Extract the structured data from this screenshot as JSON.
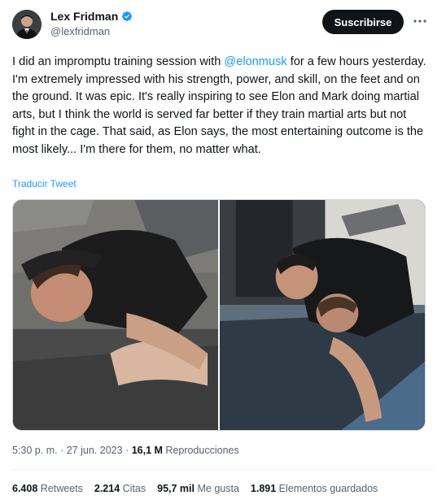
{
  "author": {
    "display_name": "Lex Fridman",
    "handle": "@lexfridman",
    "verified": true
  },
  "actions": {
    "subscribe_label": "Suscribirse"
  },
  "tweet": {
    "text_before": "I did an impromptu training session with ",
    "mention": "@elonmusk",
    "text_after": " for a few hours yesterday. I'm extremely impressed with his strength, power, and skill, on the feet and on the ground. It was epic. It's really inspiring to see Elon and Mark doing martial arts, but I think the world is served far better if they train martial arts but not fight in the cage. That said, as Elon says, the most entertaining outcome is the most likely... I'm there for them, no matter what.",
    "translate_label": "Traducir Tweet"
  },
  "meta": {
    "time": "5:30 p. m.",
    "separator": "·",
    "date": "27 jun. 2023",
    "views_count": "16,1 M",
    "views_label": "Reproducciones"
  },
  "stats": [
    {
      "count": "6.408",
      "label": "Retweets"
    },
    {
      "count": "2.214",
      "label": "Citas"
    },
    {
      "count": "95,7 mil",
      "label": "Me gusta"
    },
    {
      "count": "1.891",
      "label": "Elementos guardados"
    }
  ],
  "colors": {
    "accent": "#1d9bf0",
    "text": "#0f1419",
    "secondary": "#536471",
    "button_bg": "#0f1419"
  }
}
